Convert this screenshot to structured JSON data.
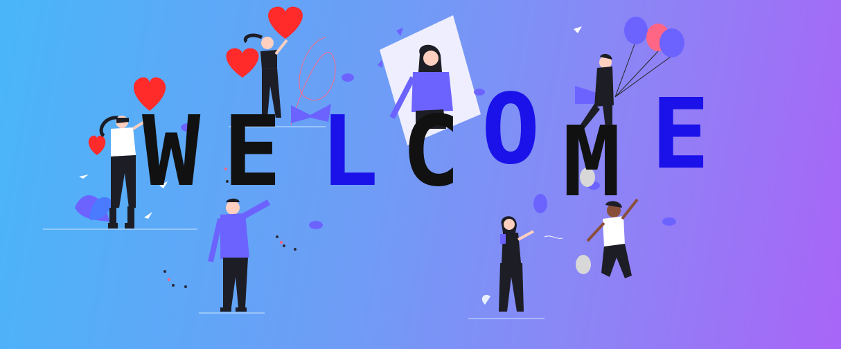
{
  "banner": {
    "letters": [
      {
        "char": "W",
        "color": "#111111"
      },
      {
        "char": "E",
        "color": "#111111"
      },
      {
        "char": "L",
        "color": "#1a12e8"
      },
      {
        "char": "C",
        "color": "#111111"
      },
      {
        "char": "O",
        "color": "#1a12e8"
      },
      {
        "char": "M",
        "color": "#111111"
      },
      {
        "char": "E",
        "color": "#1a12e8"
      }
    ]
  },
  "colors": {
    "background_start": "#49b6f9",
    "background_end": "#a865f7",
    "accent_purple": "#6c63ff",
    "heart_red": "#ff2a2a",
    "balloon_pink": "#ff6584",
    "figure_dark": "#1d1d26"
  }
}
